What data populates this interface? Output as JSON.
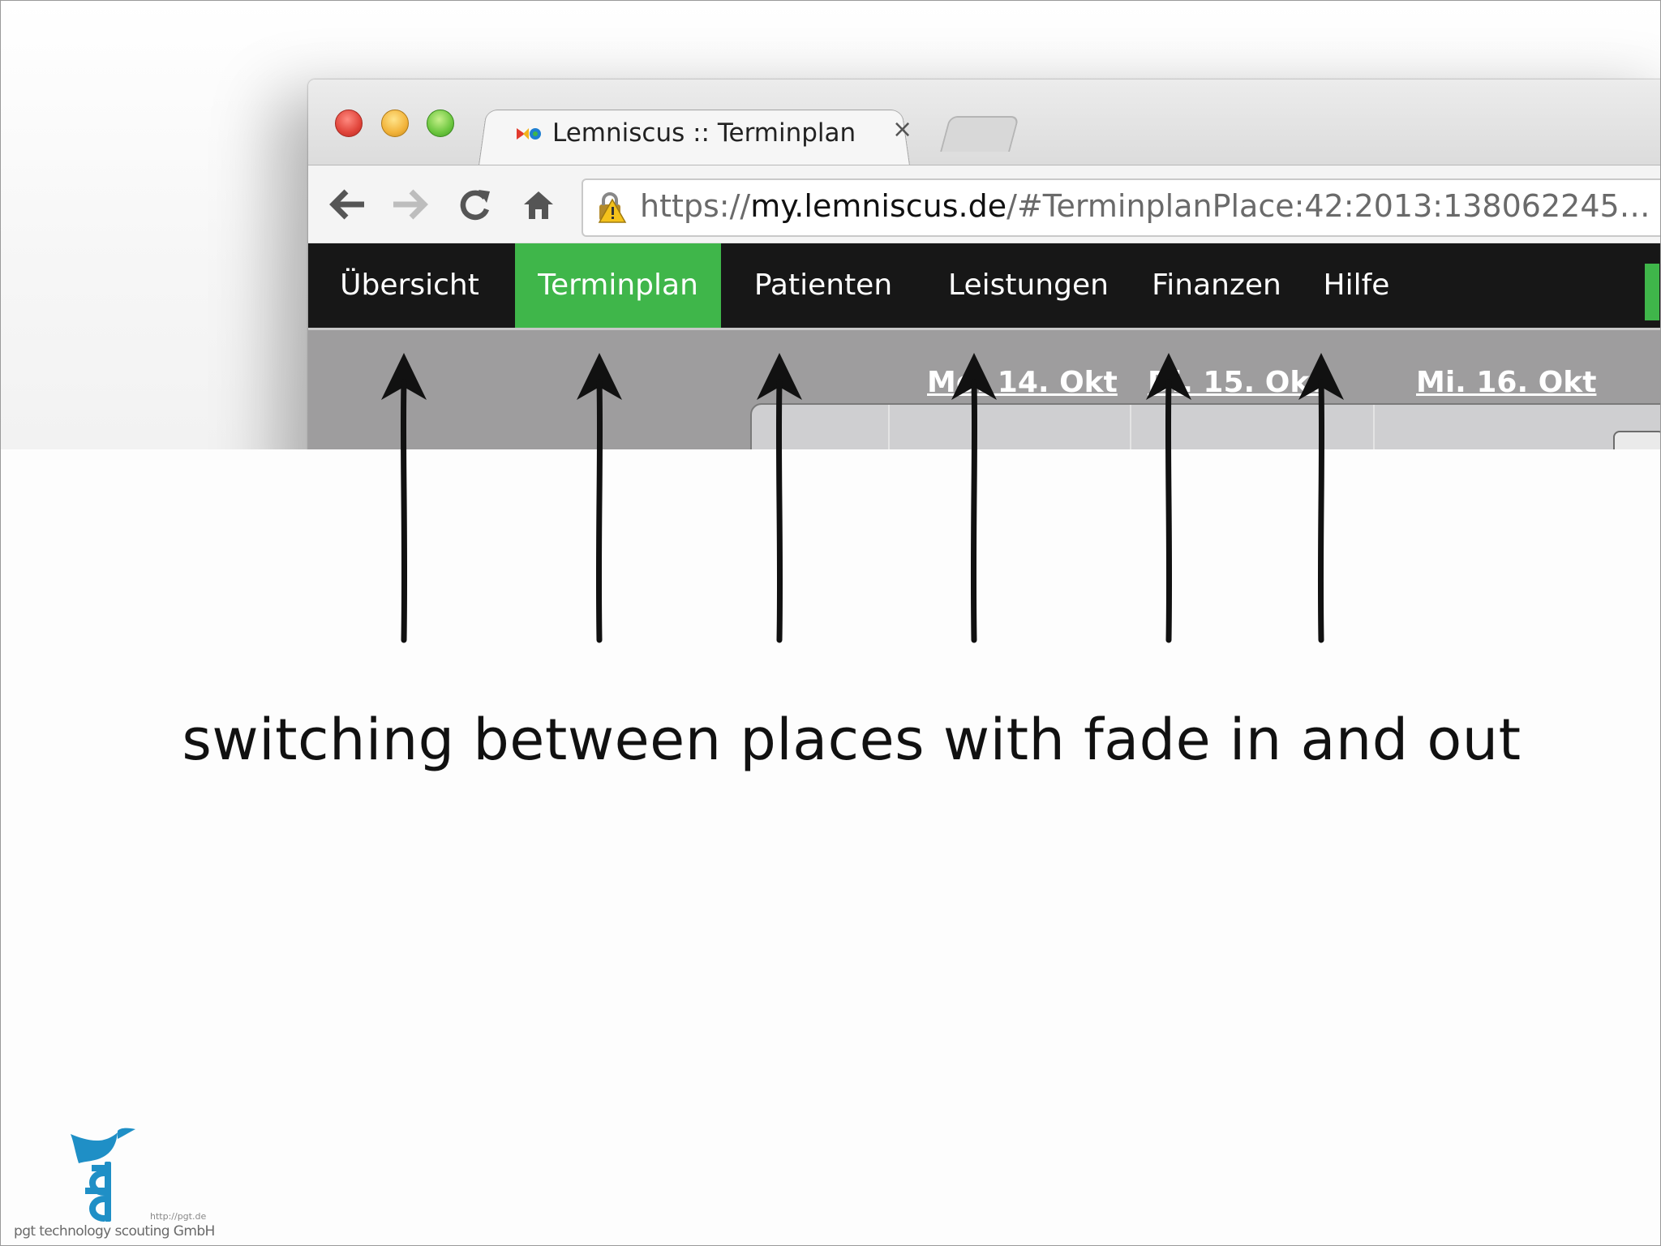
{
  "browser": {
    "tab_title": "Lemniscus :: Terminplan",
    "tab_close": "×",
    "url_prefix": "https://",
    "url_host": "my.lemniscus.de",
    "url_path": "/#TerminplanPlace:42:2013:138062245…"
  },
  "app_nav": {
    "items": [
      "Übersicht",
      "Terminplan",
      "Patienten",
      "Leistungen",
      "Finanzen",
      "Hilfe"
    ],
    "active": "Terminplan",
    "accent_color": "#3fb64a"
  },
  "calendar": {
    "days": [
      "Mo. 14. Okt",
      "Di. 15. Okt",
      "Mi. 16. Okt"
    ]
  },
  "caption": "switching between places with fade in and out",
  "logo": {
    "url": "http://pgt.de",
    "company": "pgt technology scouting GmbH",
    "brand_color": "#1f8fc6"
  },
  "icons": [
    "back-arrow-icon",
    "forward-arrow-icon",
    "reload-icon",
    "home-icon",
    "lock-warning-icon",
    "up-arrow-icon"
  ]
}
